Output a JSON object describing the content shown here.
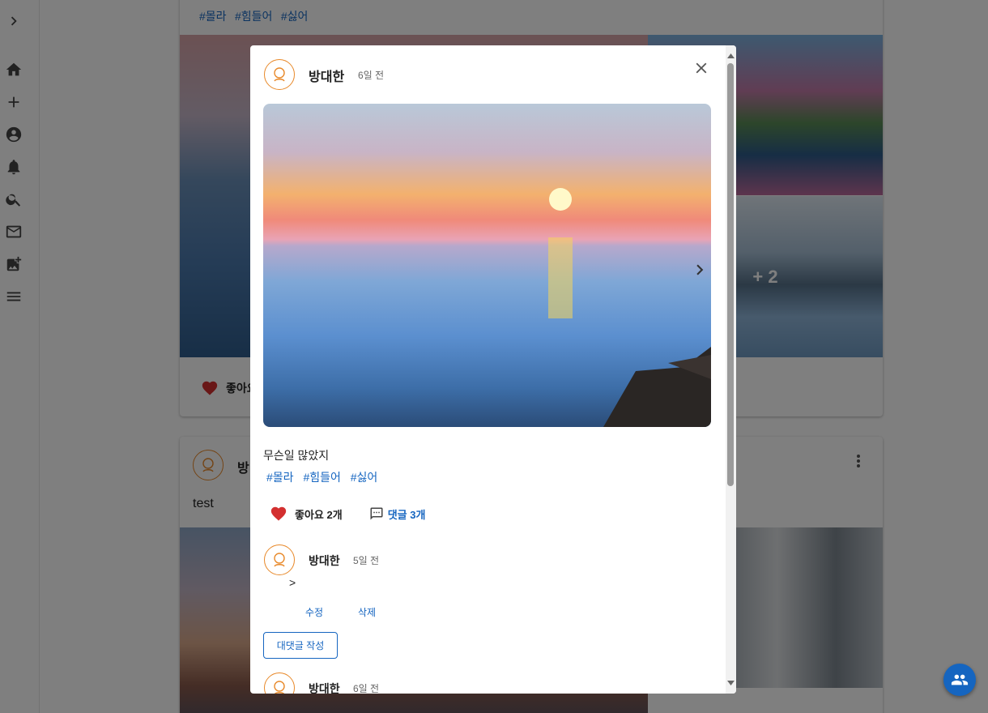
{
  "sidebar": {
    "icons": [
      "chevron-right-icon",
      "home-icon",
      "plus-icon",
      "account-circle-icon",
      "bell-icon",
      "search-icon",
      "mail-icon",
      "add-photo-icon",
      "menu-icon"
    ]
  },
  "feed": {
    "post1": {
      "tags": [
        "#몰라",
        "#힘들어",
        "#싫어"
      ],
      "more_images": "+ 2",
      "like_label": "좋아요"
    },
    "post2": {
      "author": "방",
      "text": "test"
    }
  },
  "modal": {
    "author": "방대한",
    "time": "6일 전",
    "text": "무슨일 많았지",
    "tags": [
      "#몰라",
      "#힘들어",
      "#싫어"
    ],
    "like_label": "좋아요 2개",
    "comment_label": "댓글 3개",
    "comments": [
      {
        "author": "방대한",
        "time": "5일 전",
        "body": ">",
        "edit_label": "수정",
        "delete_label": "삭제",
        "reply_label": "대댓글 작성"
      },
      {
        "author": "방대한",
        "time": "6일 전"
      }
    ]
  },
  "colors": {
    "accent": "#1565c0",
    "heart": "#d32f2f",
    "avatar_border": "#e8892a",
    "overlay": "rgba(0,0,0,0.5)"
  }
}
